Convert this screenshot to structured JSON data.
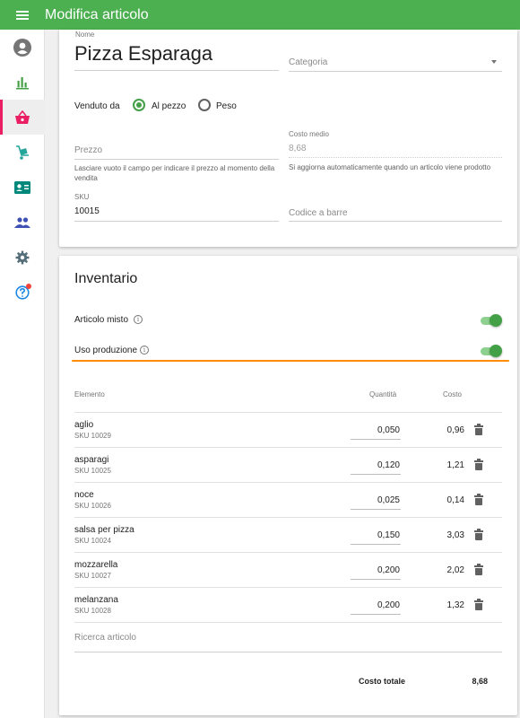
{
  "appbar": {
    "title": "Modifica articolo"
  },
  "sidebar": {
    "items": [
      {
        "icon": "account-circle-icon",
        "color": "#757575"
      },
      {
        "icon": "bar-chart-icon",
        "color": "#43a047"
      },
      {
        "icon": "basket-icon",
        "color": "#e91e63",
        "active": true
      },
      {
        "icon": "truck-icon",
        "color": "#26a69a"
      },
      {
        "icon": "contact-card-icon",
        "color": "#00897b"
      },
      {
        "icon": "people-icon",
        "color": "#3f51b5"
      },
      {
        "icon": "gear-icon",
        "color": "#546e7a"
      },
      {
        "icon": "help-icon",
        "color": "#1e88e5"
      }
    ]
  },
  "item": {
    "name_label": "Nome",
    "name": "Pizza Esparaga",
    "category_placeholder": "Categoria",
    "sold_by_label": "Venduto da",
    "sold_by_options": [
      "Al pezzo",
      "Peso"
    ],
    "price_placeholder": "Prezzo",
    "price_hint": "Lasciare vuoto il campo per indicare il prezzo al momento della vendita",
    "avg_cost_label": "Costo medio",
    "avg_cost": "8,68",
    "avg_cost_hint": "Si aggiorna automaticamente quando un articolo viene prodotto",
    "sku_label": "SKU",
    "sku": "10015",
    "barcode_placeholder": "Codice a barre"
  },
  "inventory": {
    "title": "Inventario",
    "mixed_label": "Articolo misto",
    "production_label": "Uso produzione",
    "headers": {
      "element": "Elemento",
      "quantity": "Quantità",
      "cost": "Costo"
    },
    "rows": [
      {
        "name": "aglio",
        "sku": "SKU 10029",
        "qty": "0,050",
        "cost": "0,96"
      },
      {
        "name": "asparagi",
        "sku": "SKU 10025",
        "qty": "0,120",
        "cost": "1,21"
      },
      {
        "name": "noce",
        "sku": "SKU 10026",
        "qty": "0,025",
        "cost": "0,14"
      },
      {
        "name": "salsa per pizza",
        "sku": "SKU 10024",
        "qty": "0,150",
        "cost": "3,03"
      },
      {
        "name": "mozzarella",
        "sku": "SKU 10027",
        "qty": "0,200",
        "cost": "2,02"
      },
      {
        "name": "melanzana",
        "sku": "SKU 10028",
        "qty": "0,200",
        "cost": "1,32"
      }
    ],
    "search_placeholder": "Ricerca articolo",
    "total_label": "Costo totale",
    "total_value": "8,68"
  }
}
